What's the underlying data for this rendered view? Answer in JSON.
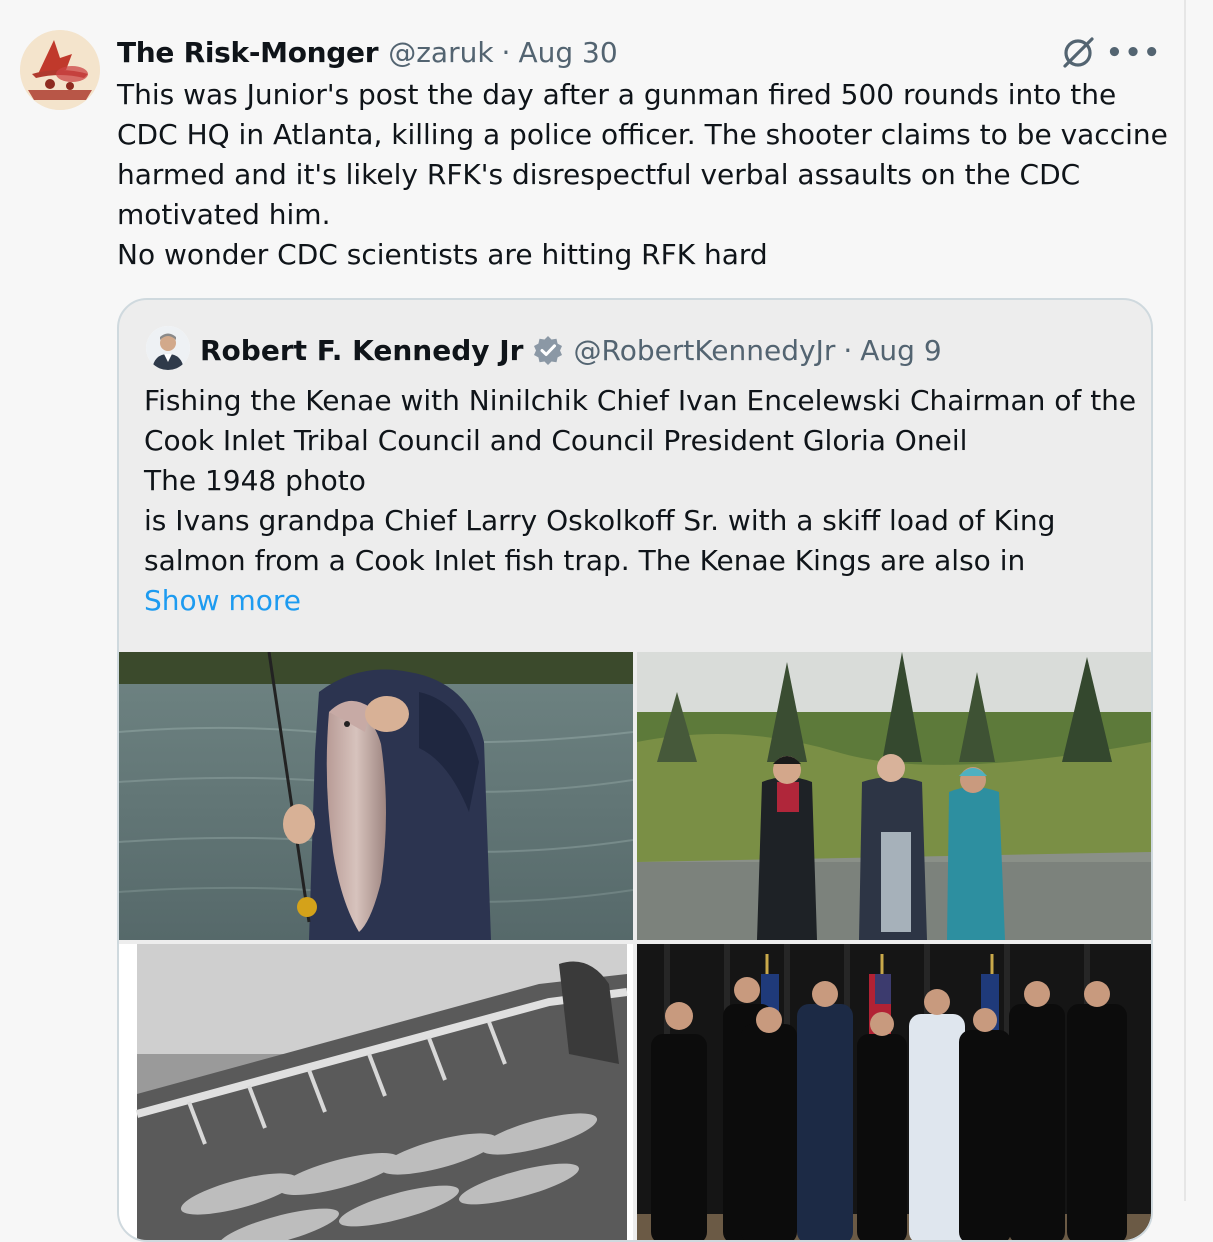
{
  "post": {
    "author_name": "The Risk-Monger",
    "author_handle": "@zaruk",
    "separator": "·",
    "date": "Aug 30",
    "more_label": "•••",
    "body_lines": [
      "This was Junior's post the day after a gunman fired 500 rounds into the",
      "CDC HQ in Atlanta, killing a police officer. The shooter claims to be vaccine",
      "harmed and it's likely RFK's disrespectful verbal assaults on the CDC",
      "motivated him.",
      "No wonder CDC scientists are hitting RFK hard"
    ]
  },
  "quote": {
    "author_name": "Robert F. Kennedy Jr",
    "author_handle": "@RobertKennedyJr",
    "separator": "·",
    "date": "Aug 9",
    "text_lines": [
      "Fishing the Kenae with Ninilchik Chief Ivan Encelewski Chairman of the",
      "Cook Inlet Tribal Council and Council President Gloria Oneil",
      "The 1948 photo",
      "is Ivans grandpa Chief Larry Oskolkoff Sr. with a skiff load of King",
      "salmon from a Cook Inlet fish trap. The Kenae Kings are also in"
    ],
    "show_more": "Show more",
    "photos": [
      {
        "name": "photo-fisherman-salmon"
      },
      {
        "name": "photo-group-river"
      },
      {
        "name": "photo-1948-skiff"
      },
      {
        "name": "photo-council-group"
      }
    ]
  },
  "colors": {
    "link": "#1d9bf0",
    "secondary_text": "#536471",
    "verified_badge": "#8b98a5"
  },
  "icons": [
    "grok-icon",
    "more-icon",
    "verified-icon"
  ]
}
